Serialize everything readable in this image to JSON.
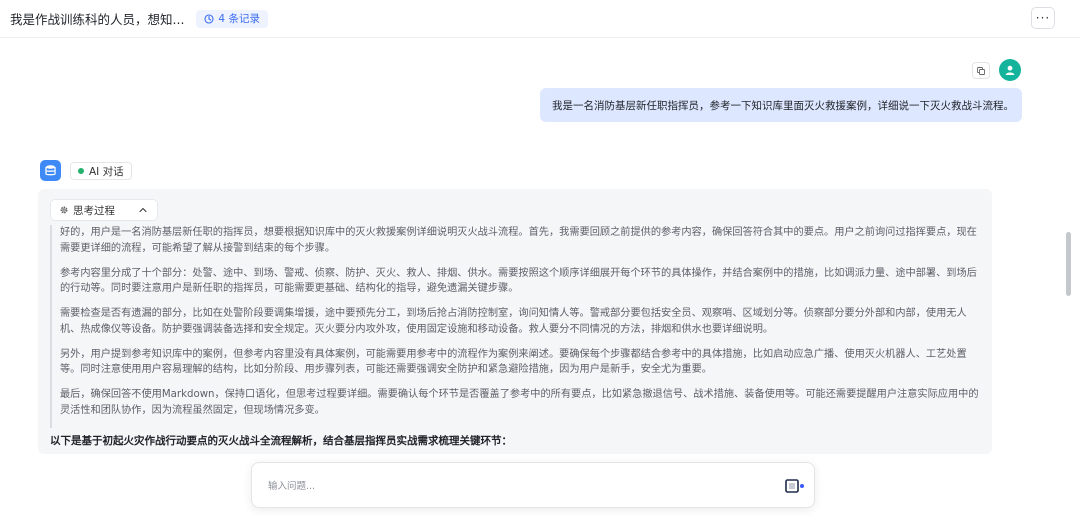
{
  "header": {
    "title": "我是作战训练科的人员，想知...",
    "records": "4 条记录",
    "more": "···"
  },
  "user_message": {
    "text": "我是一名消防基层新任职指挥员，参考一下知识库里面灭火救援案例，详细说一下灭火救战斗流程。"
  },
  "assistant": {
    "tag": "AI 对话",
    "think_label": "思考过程",
    "paragraphs": [
      "好的，用户是一名消防基层新任职的指挥员，想要根据知识库中的灭火救援案例详细说明灭火战斗流程。首先，我需要回顾之前提供的参考内容，确保回答符合其中的要点。用户之前询问过指挥要点，现在需要更详细的流程，可能希望了解从接警到结束的每个步骤。",
      "参考内容里分成了十个部分：处警、途中、到场、警戒、侦察、防护、灭火、救人、排烟、供水。需要按照这个顺序详细展开每个环节的具体操作，并结合案例中的措施，比如调派力量、途中部署、到场后的行动等。同时要注意用户是新任职的指挥员，可能需要更基础、结构化的指导，避免遗漏关键步骤。",
      "需要检查是否有遗漏的部分，比如在处警阶段要调集增援，途中要预先分工，到场后抢占消防控制室，询问知情人等。警戒部分要包括安全员、观察哨、区域划分等。侦察部分要分外部和内部，使用无人机、热成像仪等设备。防护要强调装备选择和安全规定。灭火要分内攻外攻，使用固定设施和移动设备。救人要分不同情况的方法，排烟和供水也要详细说明。",
      "另外，用户提到参考知识库中的案例，但参考内容里没有具体案例，可能需要用参考中的流程作为案例来阐述。要确保每个步骤都结合参考中的具体措施，比如启动应急广播、使用灭火机器人、工艺处置等。同时注意使用用户容易理解的结构，比如分阶段、用步骤列表，可能还需要强调安全防护和紧急避险措施，因为用户是新手，安全尤为重要。",
      "最后，确保回答不使用Markdown，保持口语化，但思考过程要详细。需要确认每个环节是否覆盖了参考中的所有要点，比如紧急撤退信号、战术措施、装备使用等。可能还需要提醒用户注意实际应用中的灵活性和团队协作，因为流程虽然固定，但现场情况多变。"
    ],
    "summary": "以下是基于初起火灾作战行动要点的灭火战斗全流程解析，结合基层指挥员实战需求梳理关键环节："
  },
  "input": {
    "placeholder": "输入问题..."
  },
  "colors": {
    "accent": "#3b6cf0",
    "user_bubble": "#dde7ff",
    "avatar": "#13b49b",
    "status_dot": "#23b26d"
  }
}
